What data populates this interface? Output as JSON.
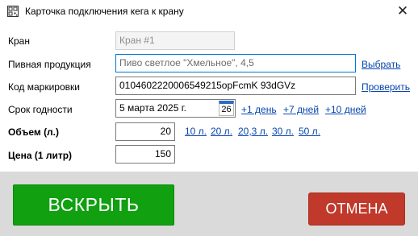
{
  "window": {
    "title": "Карточка подключения кега к крану",
    "icon": "qr-code-icon",
    "close_icon": "close-icon"
  },
  "form": {
    "tap": {
      "label": "Кран",
      "value": "Кран #1"
    },
    "beer": {
      "label": "Пивная продукция",
      "value": "Пиво светлое \"Хмельное\", 4,5",
      "action": "Выбрать"
    },
    "marking": {
      "label": "Код маркировки",
      "value": "0104602220006549215opFcmK 93dGVz",
      "action": "Проверить"
    },
    "expiry": {
      "label": "Срок годности",
      "value": "5 марта 2025 г.",
      "calendar_day": "26",
      "quick_links": [
        "+1 день",
        "+7 дней",
        "+10 дней"
      ]
    },
    "volume": {
      "label": "Объем (л.)",
      "value": "20",
      "presets": [
        "10 л.",
        "20 л.",
        "20,3 л.",
        "30 л.",
        "50 л."
      ]
    },
    "price": {
      "label": "Цена (1 литр)",
      "value": "150"
    }
  },
  "buttons": {
    "open": "ВСКРЫТЬ",
    "cancel": "ОТМЕНА"
  },
  "colors": {
    "open_button": "#10a010",
    "cancel_button": "#c0392b",
    "link": "#0645ad",
    "focus_border": "#0078d4"
  }
}
